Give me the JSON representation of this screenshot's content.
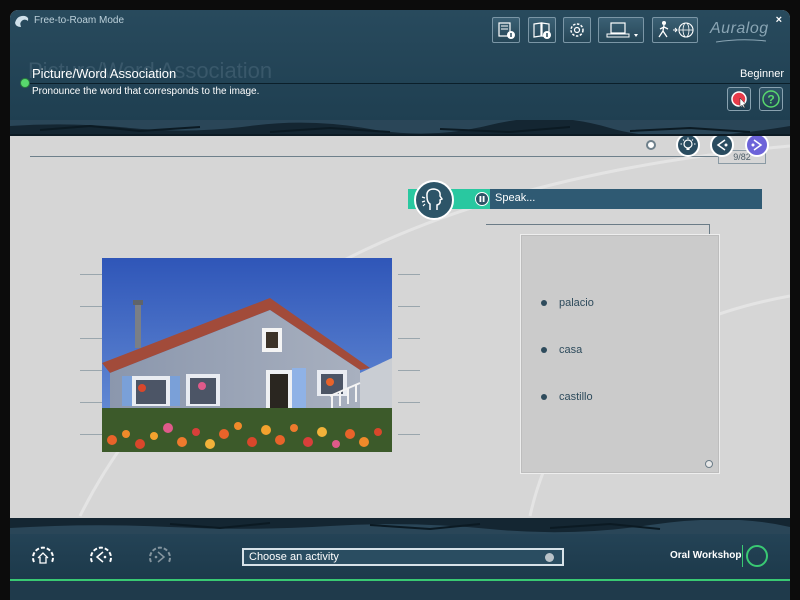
{
  "window": {
    "mode_label": "Free-to-Roam Mode",
    "close_label": "×",
    "brand": "Auralog"
  },
  "toolbar": {
    "icons": [
      "notepad-info-icon",
      "book-info-icon",
      "gear-icon",
      "computer-dropdown-icon",
      "walker-globe-icon"
    ]
  },
  "activity": {
    "title": "Picture/Word Association",
    "ghost_title": "Picture/Word Association",
    "instruction": "Pronounce the word that corresponds to the image.",
    "level": "Beginner"
  },
  "progress": {
    "counter": "9/82",
    "current": 9,
    "total": 82
  },
  "speak": {
    "label": "Speak..."
  },
  "answers": [
    {
      "text": "palacio"
    },
    {
      "text": "casa"
    },
    {
      "text": "castillo"
    }
  ],
  "bottom": {
    "activity_select_placeholder": "Choose an activity",
    "workshop_label": "Oral Workshop"
  },
  "colors": {
    "header": "#284a5d",
    "accent_green": "#39c973",
    "speak_green": "#29c8a0",
    "text_dark": "#2e4b5c"
  }
}
